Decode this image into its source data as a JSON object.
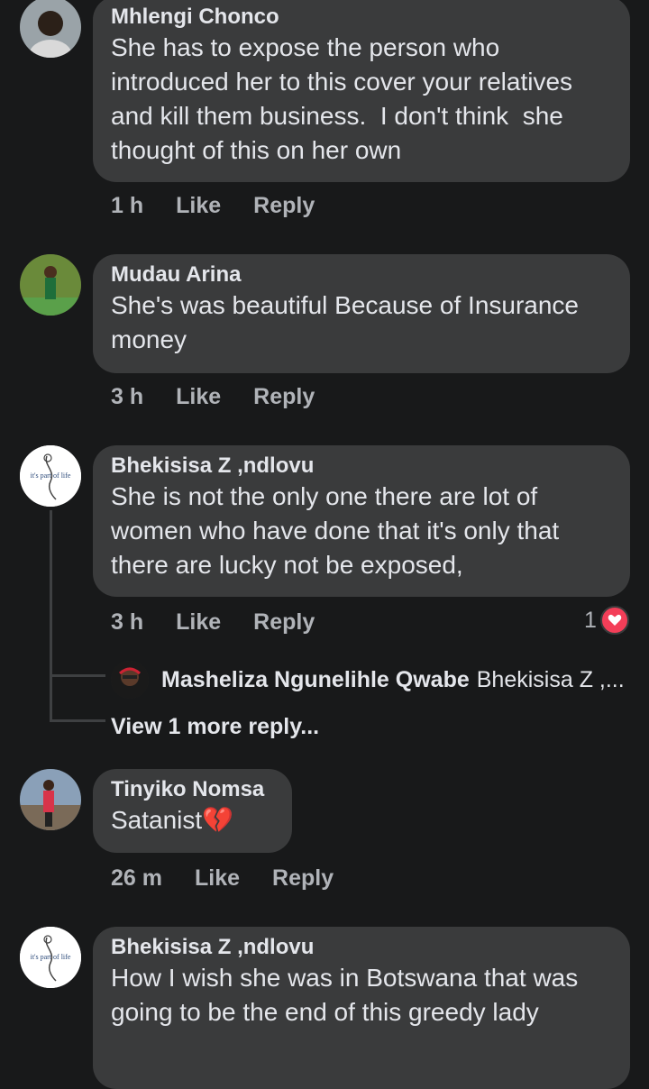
{
  "comments": [
    {
      "author": "Mhlengi Chonco",
      "text": "She has to expose the person who introduced her to this cover your relatives and kill them business.  I don't think  she thought of this on her own",
      "time": "1 h",
      "like": "Like",
      "reply": "Reply"
    },
    {
      "author": "Mudau Arina",
      "text": "She's was beautiful Because of Insurance money",
      "time": "3 h",
      "like": "Like",
      "reply": "Reply"
    },
    {
      "author": "Bhekisisa Z ,ndlovu",
      "avatar_text": "it's part of life",
      "text": "She is not the only one there are lot of women who have done that it's only that there are lucky not be exposed,",
      "time": "3 h",
      "like": "Like",
      "reply": "Reply",
      "reaction_count": "1",
      "reply_preview": {
        "author": "Masheliza Ngunelihle Qwabe",
        "text": "Bhekisisa Z ,..."
      },
      "view_more": "View 1 more reply..."
    },
    {
      "author": "Tinyiko Nomsa",
      "text": "Satanist💔",
      "time": "26 m",
      "like": "Like",
      "reply": "Reply"
    },
    {
      "author": "Bhekisisa Z ,ndlovu",
      "avatar_text": "it's part of life",
      "text": "How I wish she was in Botswana that was going to be the end of this greedy lady"
    }
  ],
  "colors": {
    "background": "#18191a",
    "bubble": "#3a3b3c",
    "muted": "#b0b3b8",
    "heart": "#f33e58"
  }
}
